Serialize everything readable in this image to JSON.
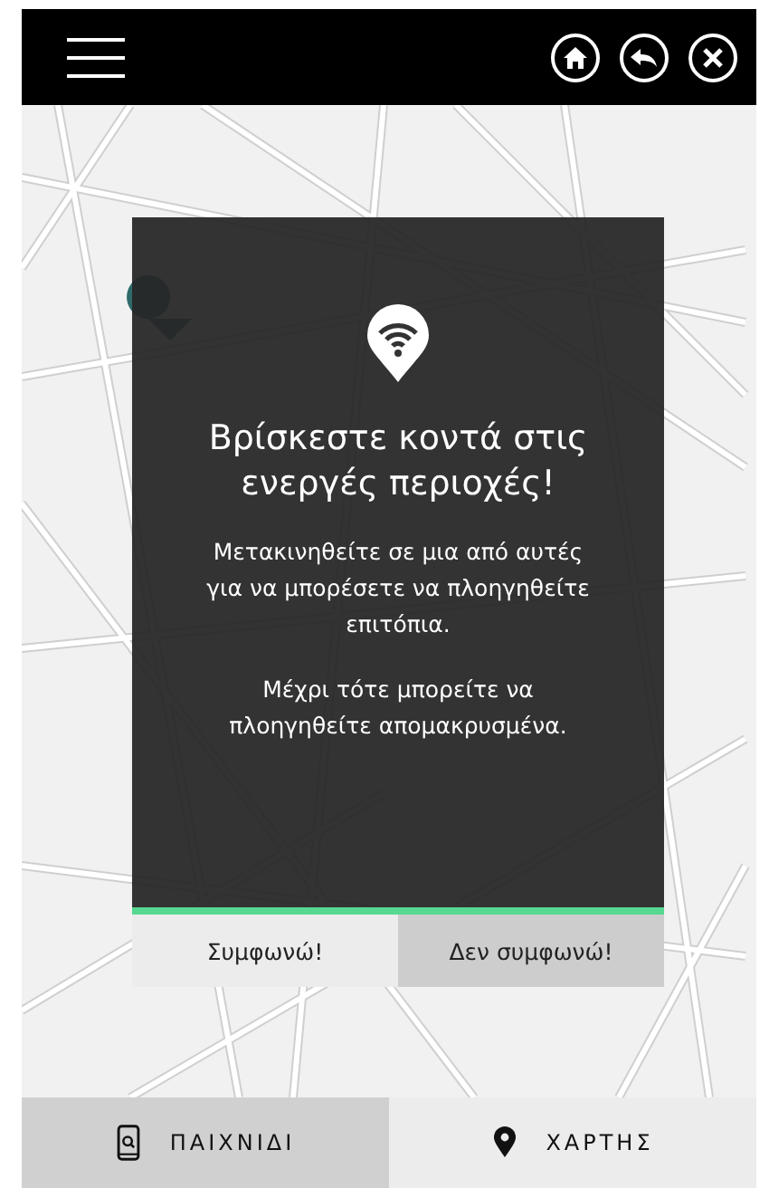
{
  "dialog": {
    "title": "Βρίσκεστε κοντά στις ενεργές περιοχές!",
    "paragraphs": [
      "Μετακινηθείτε σε μια από αυτές για να μπορέσετε να πλοηγηθείτε επιτόπια.",
      "Μέχρι τότε μπορείτε να πλοηγηθείτε απομακρυσμένα."
    ],
    "buttons": [
      {
        "label": "Συμφωνώ!",
        "kind": "accept"
      },
      {
        "label": "Δεν συμφωνώ!",
        "kind": "decline"
      }
    ]
  },
  "tabs": [
    {
      "label": "ΠΑΙΧΝΙΔΙ",
      "kind": "game",
      "selected": true
    },
    {
      "label": "ΧΑΡΤΗΣ",
      "kind": "map",
      "selected": false
    }
  ]
}
